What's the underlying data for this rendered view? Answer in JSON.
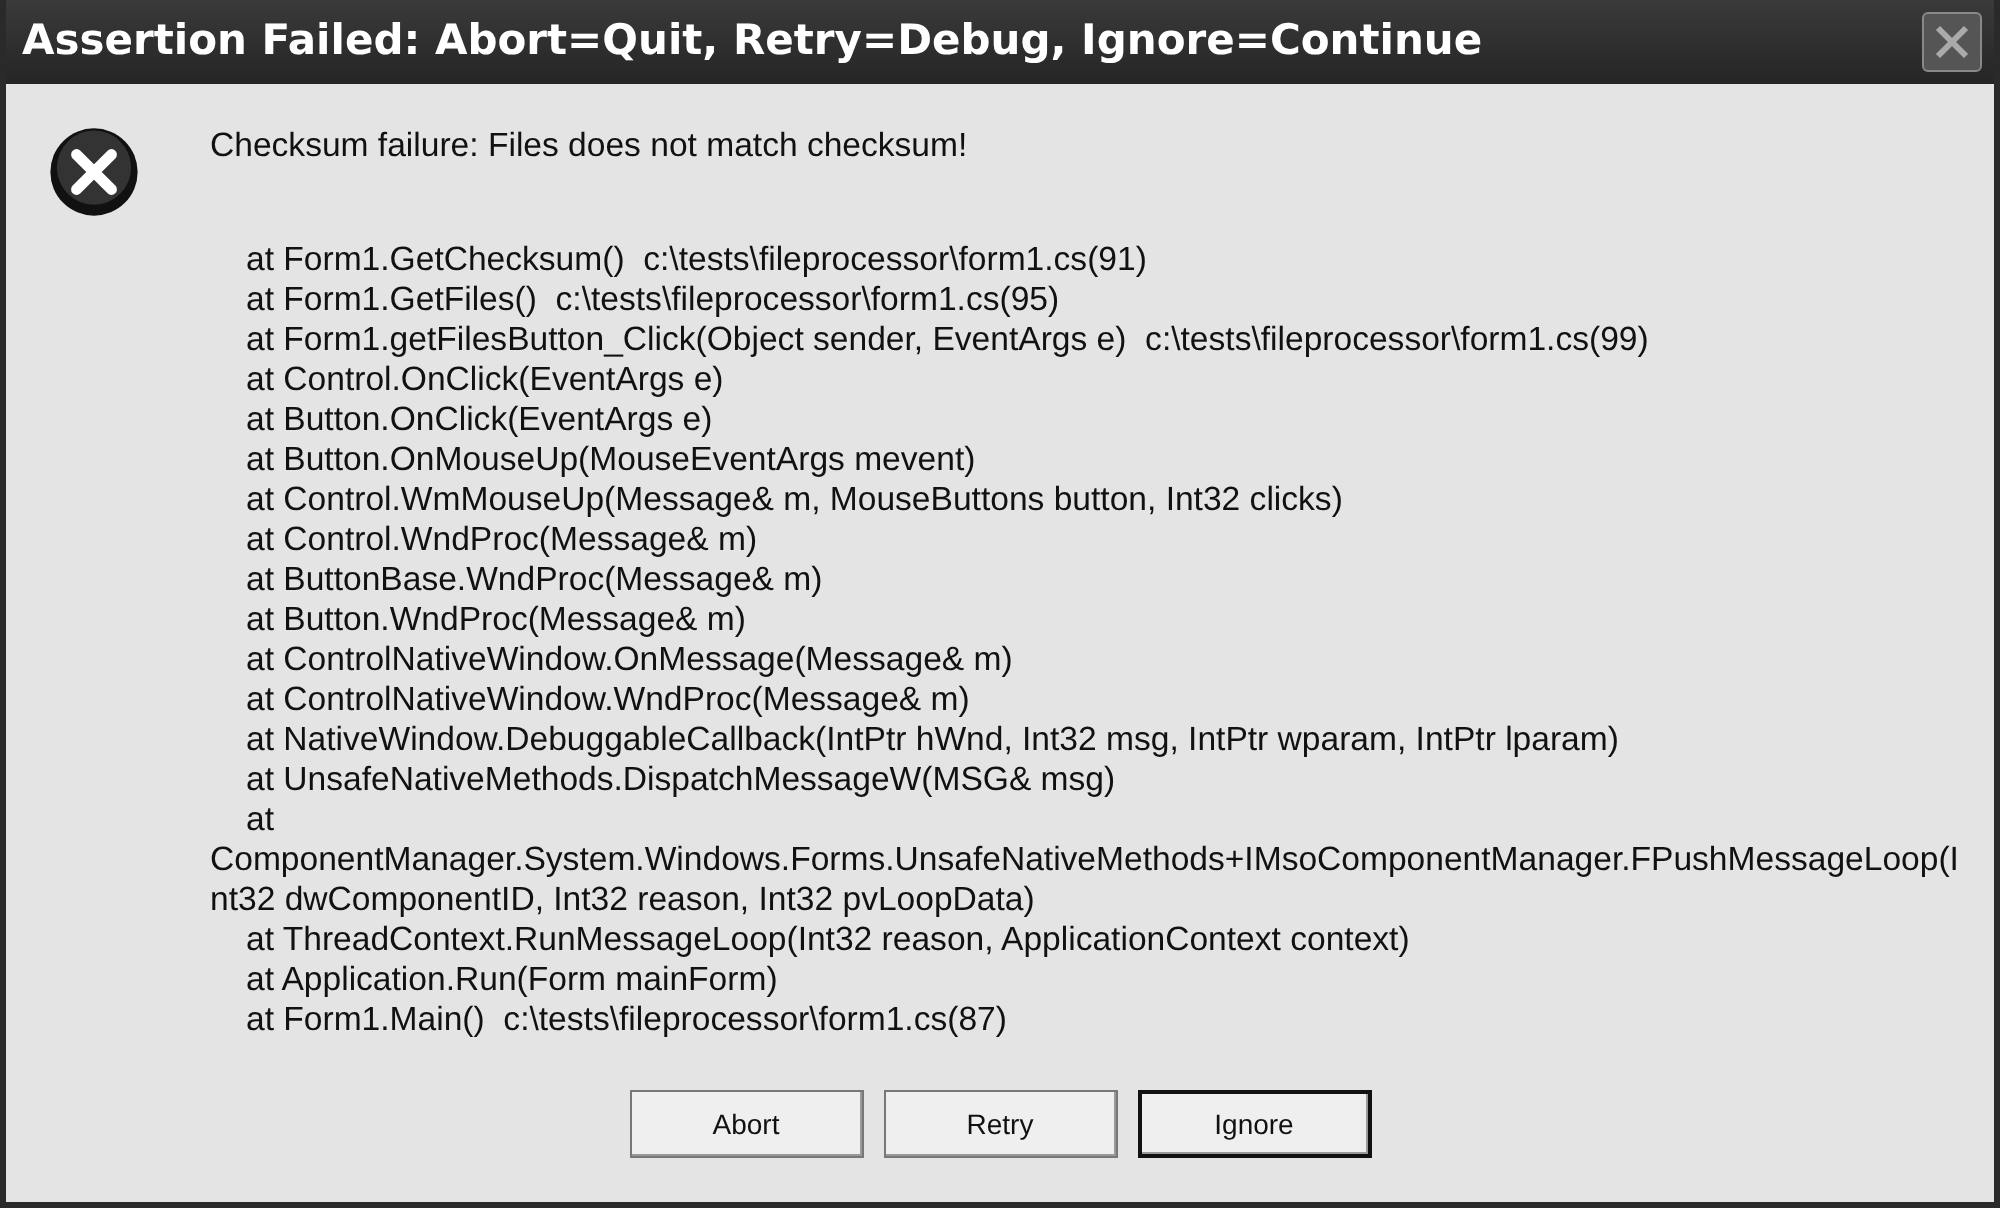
{
  "window": {
    "title": "Assertion Failed: Abort=Quit, Retry=Debug, Ignore=Continue"
  },
  "message": "Checksum failure: Files does not match checksum!",
  "stack_lines": [
    {
      "text": "at Form1.GetChecksum()  c:\\tests\\fileprocessor\\form1.cs(91)",
      "indented": true
    },
    {
      "text": "at Form1.GetFiles()  c:\\tests\\fileprocessor\\form1.cs(95)",
      "indented": true
    },
    {
      "text": "at Form1.getFilesButton_Click(Object sender, EventArgs e)  c:\\tests\\fileprocessor\\form1.cs(99)",
      "indented": true
    },
    {
      "text": "at Control.OnClick(EventArgs e)",
      "indented": true
    },
    {
      "text": "at Button.OnClick(EventArgs e)",
      "indented": true
    },
    {
      "text": "at Button.OnMouseUp(MouseEventArgs mevent)",
      "indented": true
    },
    {
      "text": "at Control.WmMouseUp(Message& m, MouseButtons button, Int32 clicks)",
      "indented": true
    },
    {
      "text": "at Control.WndProc(Message& m)",
      "indented": true
    },
    {
      "text": "at ButtonBase.WndProc(Message& m)",
      "indented": true
    },
    {
      "text": "at Button.WndProc(Message& m)",
      "indented": true
    },
    {
      "text": "at ControlNativeWindow.OnMessage(Message& m)",
      "indented": true
    },
    {
      "text": "at ControlNativeWindow.WndProc(Message& m)",
      "indented": true
    },
    {
      "text": "at NativeWindow.DebuggableCallback(IntPtr hWnd, Int32 msg, IntPtr wparam, IntPtr lparam)",
      "indented": true
    },
    {
      "text": "at UnsafeNativeMethods.DispatchMessageW(MSG& msg)",
      "indented": true
    },
    {
      "text": "at",
      "indented": true
    },
    {
      "text": "ComponentManager.System.Windows.Forms.UnsafeNativeMethods+IMsoComponentManager.FPushMessageLoop(I",
      "indented": false
    },
    {
      "text": "nt32 dwComponentID, Int32 reason, Int32 pvLoopData)",
      "indented": false
    },
    {
      "text": "at ThreadContext.RunMessageLoop(Int32 reason, ApplicationContext context)",
      "indented": true
    },
    {
      "text": "at Application.Run(Form mainForm)",
      "indented": true
    },
    {
      "text": "at Form1.Main()  c:\\tests\\fileprocessor\\form1.cs(87)",
      "indented": true
    }
  ],
  "buttons": [
    {
      "label": "Abort",
      "default": false
    },
    {
      "label": "Retry",
      "default": false
    },
    {
      "label": "Ignore",
      "default": true
    }
  ]
}
